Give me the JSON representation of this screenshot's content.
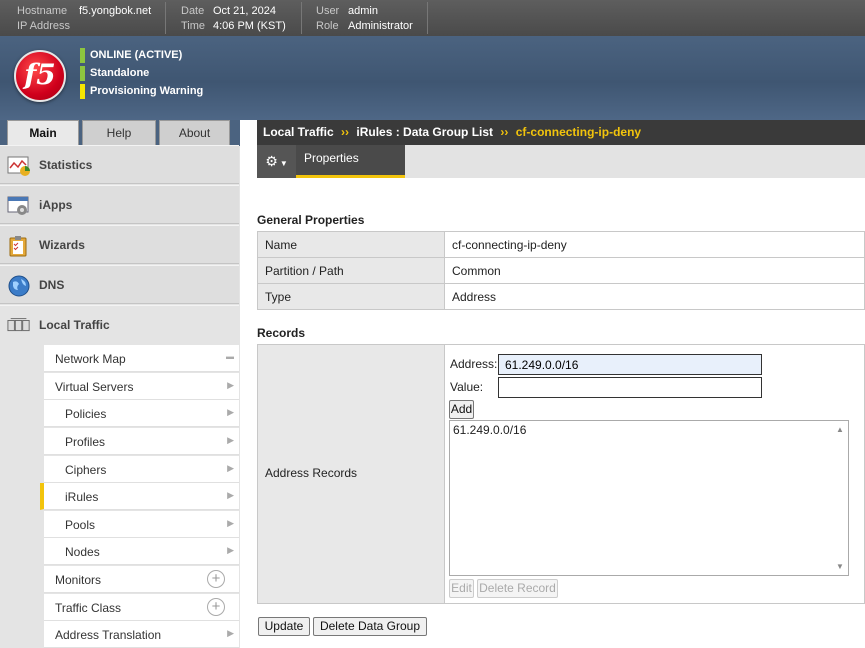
{
  "topbar": {
    "hostname_label": "Hostname",
    "hostname_value": "f5.yongbok.net",
    "ip_label": "IP Address",
    "ip_value": "",
    "date_label": "Date",
    "date_value": "Oct 21, 2024",
    "time_label": "Time",
    "time_value": "4:06 PM (KST)",
    "user_label": "User",
    "user_value": "admin",
    "role_label": "Role",
    "role_value": "Administrator"
  },
  "banner": {
    "logo_text": "f5",
    "status": [
      {
        "text": "ONLINE (ACTIVE)",
        "color": "#8dc63f"
      },
      {
        "text": "Standalone",
        "color": "#8dc63f"
      },
      {
        "text": "Provisioning Warning",
        "color": "#f5e600"
      }
    ]
  },
  "tabs": {
    "main": "Main",
    "help": "Help",
    "about": "About"
  },
  "nav": {
    "sections": [
      {
        "label": "Statistics",
        "icon": "statistics-icon"
      },
      {
        "label": "iApps",
        "icon": "iapps-icon"
      },
      {
        "label": "Wizards",
        "icon": "wizards-icon"
      },
      {
        "label": "DNS",
        "icon": "dns-globe-icon"
      },
      {
        "label": "Local Traffic",
        "icon": "local-traffic-icon"
      }
    ],
    "sub": [
      {
        "label": "Network Map"
      },
      {
        "label": "Virtual Servers"
      },
      {
        "label": "Policies"
      },
      {
        "label": "Profiles"
      },
      {
        "label": "Ciphers"
      },
      {
        "label": "iRules"
      },
      {
        "label": "Pools"
      },
      {
        "label": "Nodes"
      },
      {
        "label": "Monitors"
      },
      {
        "label": "Traffic Class"
      },
      {
        "label": "Address Translation"
      }
    ]
  },
  "breadcrumb": {
    "root": "Local Traffic",
    "sep": "››",
    "mid": "iRules : Data Group List",
    "current": "cf-connecting-ip-deny"
  },
  "subtabs": {
    "properties": "Properties"
  },
  "general": {
    "title": "General Properties",
    "rows": [
      {
        "key": "Name",
        "value": "cf-connecting-ip-deny"
      },
      {
        "key": "Partition / Path",
        "value": "Common"
      },
      {
        "key": "Type",
        "value": "Address"
      }
    ]
  },
  "records": {
    "title": "Records",
    "row_label": "Address Records",
    "address_label": "Address:",
    "address_value": "61.249.0.0/16",
    "value_label": "Value:",
    "value_value": "",
    "add_label": "Add",
    "list": [
      "61.249.0.0/16"
    ],
    "edit_label": "Edit",
    "delete_record_label": "Delete Record"
  },
  "actions": {
    "update": "Update",
    "delete_group": "Delete Data Group"
  }
}
